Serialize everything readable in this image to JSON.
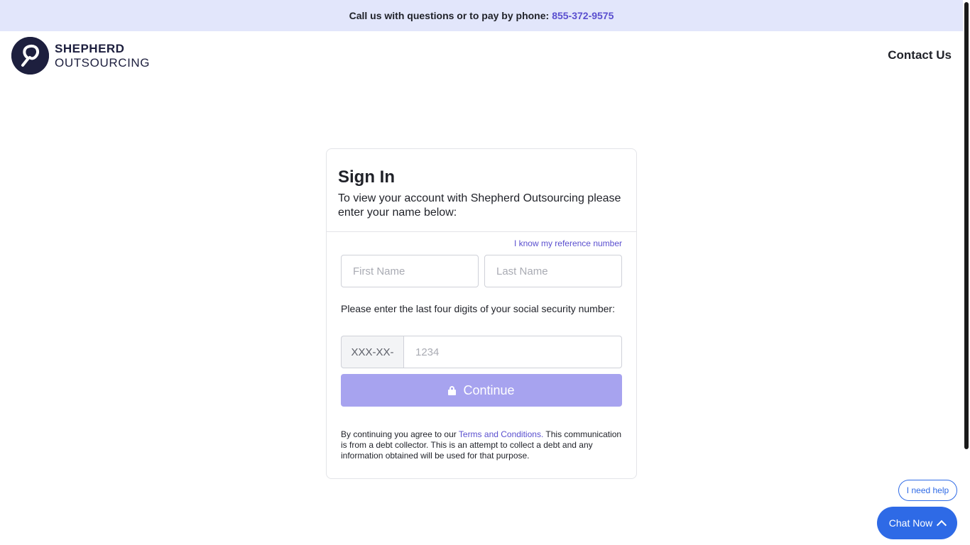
{
  "topbar": {
    "text": "Call us with questions or to pay by phone:",
    "phone": "855-372-9575"
  },
  "header": {
    "logo_line1": "SHEPHERD",
    "logo_line2": "OUTSOURCING",
    "contact_label": "Contact Us"
  },
  "signin": {
    "title": "Sign In",
    "subtitle": "To view your account with Shepherd Outsourcing please enter your name below:",
    "reference_link": "I know my reference number",
    "first_name_placeholder": "First Name",
    "last_name_placeholder": "Last Name",
    "ssn_label": "Please enter the last four digits of your social security number:",
    "ssn_prefix": "XXX-XX-",
    "ssn_placeholder": "1234",
    "continue_label": "Continue",
    "disclaimer_before": "By continuing you agree to our ",
    "terms_link": "Terms and Conditions.",
    "disclaimer_after": " This communication is from a debt collector. This is an attempt to collect a debt and any information obtained will be used for that purpose."
  },
  "chat": {
    "help_label": "I need help",
    "chat_label": "Chat Now"
  },
  "colors": {
    "accent": "#5a4fcf",
    "topbar_bg": "#e2e6fb",
    "button_disabled": "#a7a3ef",
    "chat_blue": "#2e6ae6",
    "logo_navy": "#1d1f3e"
  },
  "icons": [
    "logo-icon",
    "lock-icon",
    "chevron-up-icon"
  ]
}
